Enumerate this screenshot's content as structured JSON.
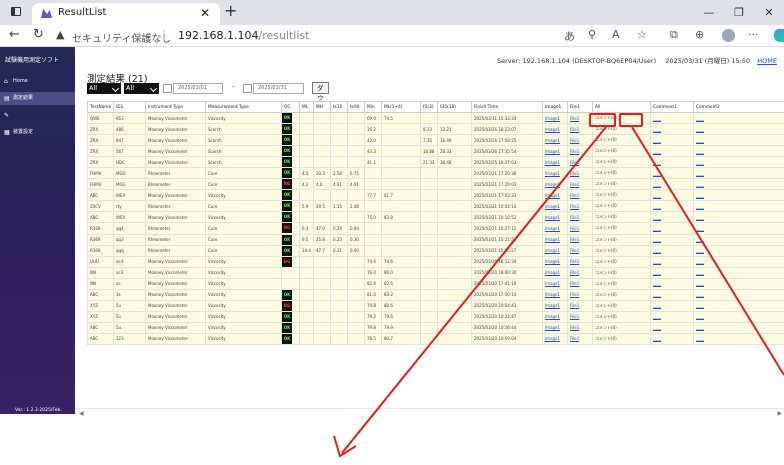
{
  "browser": {
    "tab_title": "ResultList",
    "security_label": "セキュリティ保護なし",
    "host": "192.168.1.104",
    "path": "/resultlist"
  },
  "sidebar": {
    "brand": "試験機用測定ソフト",
    "items": [
      {
        "label": "Home",
        "icon": "home-icon"
      },
      {
        "label": "測定結果",
        "icon": "list-icon"
      },
      {
        "label": "",
        "icon": "pencil-icon"
      },
      {
        "label": "装置設定",
        "icon": "device-icon"
      }
    ],
    "version": "Ver.: 1.2.3-2025/Feb."
  },
  "header": {
    "server": "Server: 192.168.1.104 (DESKTOP-BQ6EP04/User)",
    "datetime": "2025/03/31 (月曜日) 15:50",
    "home": "HOME"
  },
  "main": {
    "title": "測定結果 (21)",
    "filter1": "All",
    "filter2": "All",
    "date_from": "2025/03/01",
    "date_sep": "-",
    "date_to": "2025/03/31",
    "download": "ダウンロード"
  },
  "table": {
    "columns": [
      "TestName",
      "ID1",
      "Instrument Type",
      "Measurement Type",
      "QC",
      "ML",
      "MH",
      "ts10",
      "tc90",
      "Min",
      "ML(1+4)",
      "t5(3)",
      "t35(18)",
      "Finish Time",
      "Image1",
      "File1",
      "All",
      "Comment1",
      "Comment2"
    ],
    "rows": [
      [
        "QWE",
        "953",
        "Mooney Viscometer",
        "Viscosity",
        "OK",
        "",
        "",
        "",
        "",
        "69.0",
        "74.5",
        "",
        "",
        "2025/03/31 15:33:34",
        "Image1",
        "File1",
        "コメント(0)",
        "____",
        "____"
      ],
      [
        "ZRX",
        "486",
        "Mooney Viscometer",
        "Scorch",
        "OK",
        "",
        "",
        "",
        "",
        "35.2",
        "",
        "8.23",
        "13.21",
        "2025/03/26 18:23:07",
        "Image1",
        "File1",
        "コメント(0)",
        "____",
        "____"
      ],
      [
        "ZRX",
        "847",
        "Mooney Viscometer",
        "Scorch",
        "OK",
        "",
        "",
        "",
        "",
        "42.0",
        "",
        "7.35",
        "16.49",
        "2025/03/26 17:58:25",
        "Image1",
        "File1",
        "コメント(0)",
        "____",
        "____"
      ],
      [
        "ZRX",
        "567",
        "Mooney Viscometer",
        "Scorch",
        "OK",
        "",
        "",
        "",
        "",
        "43.3",
        "",
        "18.88",
        "28.33",
        "2025/03/26 17:35:54",
        "Image1",
        "File1",
        "コメント(0)",
        "____",
        "____"
      ],
      [
        "ZRX",
        "HDC",
        "Mooney Viscometer",
        "Scorch",
        "OK",
        "",
        "",
        "",
        "",
        "41.1",
        "",
        "21.33",
        "38.48",
        "2025/03/25 19:27:03",
        "Image1",
        "File1",
        "コメント(0)",
        "____",
        "____"
      ],
      [
        "FHMV",
        "MGG",
        "Rheometer",
        "Cure",
        "OK",
        "4.5",
        "20.3",
        "2.58",
        "6.75",
        "",
        "",
        "",
        "",
        "2025/03/21 17:20:36",
        "Image1",
        "File1",
        "コメント(0)",
        "____",
        "____"
      ],
      [
        "FHMV",
        "MGG",
        "Rheometer",
        "Cure",
        "NG",
        "4.2",
        "4.0",
        "4.91",
        "4.91",
        "",
        "",
        "",
        "",
        "2025/03/21 17:20:03",
        "Image1",
        "File1",
        "コメント(0)",
        "____",
        "____"
      ],
      [
        "ABC",
        "WEX",
        "Mooney Viscometer",
        "Viscosity",
        "OK",
        "",
        "",
        "",
        "",
        "77.7",
        "81.7",
        "",
        "",
        "2025/03/21 17:03:33",
        "Image1",
        "File1",
        "コメント(0)",
        "____",
        "____"
      ],
      [
        "ZXCV",
        "rty",
        "Rheometer",
        "Cure",
        "OK",
        "5.9",
        "29.5",
        "1.15",
        "2.48",
        "",
        "",
        "",
        "",
        "2025/03/21 10:54:14",
        "Image1",
        "File1",
        "コメント(0)",
        "____",
        "____"
      ],
      [
        "ABC",
        "WEX",
        "Mooney Viscometer",
        "Viscosity",
        "OK",
        "",
        "",
        "",
        "",
        "75.0",
        "83.8",
        "",
        "",
        "2025/03/21 10:10:52",
        "Image1",
        "File1",
        "コメント(0)",
        "____",
        "____"
      ],
      [
        "R369",
        "qq4",
        "Rheometer",
        "Cure",
        "NG",
        "6.4",
        "47.0",
        "0.24",
        "0.94",
        "",
        "",
        "",
        "",
        "2025/03/21 15:27:11",
        "Image1",
        "File1",
        "コメント(0)",
        "____",
        "____"
      ],
      [
        "R369",
        "qq3",
        "Rheometer",
        "Cure",
        "OK",
        "9.5",
        "25.8",
        "0.25",
        "0.30",
        "",
        "",
        "",
        "",
        "2025/03/21 15:21:52",
        "Image1",
        "File1",
        "コメント(0)",
        "____",
        "____"
      ],
      [
        "R369",
        "qqq",
        "Rheometer",
        "Cure",
        "OK",
        "14.4",
        "47.7",
        "0.31",
        "0.90",
        "",
        "",
        "",
        "",
        "2025/03/21 15:15:27",
        "Image1",
        "File1",
        "コメント(0)",
        "____",
        "____"
      ],
      [
        "UUU",
        "ac4",
        "Mooney Viscometer",
        "Viscosity",
        "NG",
        "",
        "",
        "",
        "",
        "74.6",
        "74.6",
        "",
        "",
        "2025/03/20 18:12:34",
        "Image1",
        "File1",
        "コメント(0)",
        "____",
        "____"
      ],
      [
        "NN",
        "ac3",
        "Mooney Viscometer",
        "Viscosity",
        "",
        "",
        "",
        "",
        "",
        "76.0",
        "80.0",
        "",
        "",
        "2025/03/20 18:00:30",
        "Image1",
        "File1",
        "コメント(0)",
        "____",
        "____"
      ],
      [
        "NN",
        "ac",
        "Mooney Viscometer",
        "Viscosity",
        "",
        "",
        "",
        "",
        "",
        "82.4",
        "82.6",
        "",
        "",
        "2025/03/20 17:41:19",
        "Image1",
        "File1",
        "コメント(0)",
        "____",
        "____"
      ],
      [
        "ABC",
        "3s",
        "Mooney Viscometer",
        "Viscosity",
        "OK",
        "",
        "",
        "",
        "",
        "81.0",
        "83.2",
        "",
        "",
        "2025/03/20 17:10:14",
        "Image1",
        "File1",
        "コメント(0)",
        "____",
        "____"
      ],
      [
        "XYZ",
        "5u",
        "Mooney Viscometer",
        "Viscosity",
        "NG",
        "",
        "",
        "",
        "",
        "74.8",
        "80.6",
        "",
        "",
        "2025/03/20 10:54:43",
        "Image1",
        "File1",
        "コメント(0)",
        "____",
        "____"
      ],
      [
        "XYZ",
        "5u",
        "Mooney Viscometer",
        "Viscosity",
        "OK",
        "",
        "",
        "",
        "",
        "79.2",
        "79.6",
        "",
        "",
        "2025/03/20 10:22:47",
        "Image1",
        "File1",
        "コメント(0)",
        "____",
        "____"
      ],
      [
        "ABC",
        "5u",
        "Mooney Viscometer",
        "Viscosity",
        "OK",
        "",
        "",
        "",
        "",
        "79.8",
        "79.9",
        "",
        "",
        "2025/03/20 10:16:44",
        "Image1",
        "File1",
        "コメント(0)",
        "____",
        "____"
      ],
      [
        "ABC",
        "123",
        "Mooney Viscometer",
        "Viscosity",
        "OK",
        "",
        "",
        "",
        "",
        "78.5",
        "80.7",
        "",
        "",
        "2025/03/20 10:09:04",
        "Image1",
        "File1",
        "コメント(0)",
        "____",
        "____"
      ]
    ]
  },
  "colors": {
    "annotation": "#e0201c",
    "ok": "#4cff4c",
    "ng": "#ff3030",
    "row_bg": "#fdfbe0"
  }
}
